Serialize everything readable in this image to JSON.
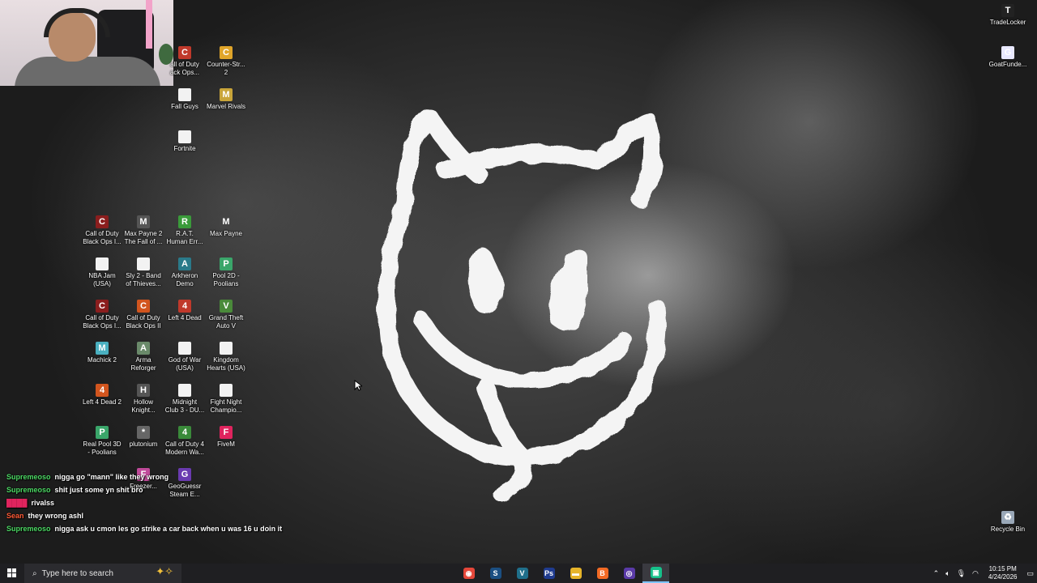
{
  "desktop": {
    "icons": [
      {
        "label": "all of Duty\nack Ops...",
        "glyph": "C",
        "color": "#c0392b"
      },
      {
        "label": "Counter-Str...\n2",
        "glyph": "C",
        "color": "#e0a52a"
      },
      {
        "label": "Fall Guys",
        "glyph": "",
        "color": "#f2f2f2"
      },
      {
        "label": "Marvel Rivals",
        "glyph": "M",
        "color": "#c9a53a"
      },
      {
        "label": "Fortnite",
        "glyph": "",
        "color": "#f2f2f2"
      },
      {
        "label": "Call of Duty\nBlack Ops I...",
        "glyph": "C",
        "color": "#8b1e1e"
      },
      {
        "label": "Max Payne 2\nThe Fall of ...",
        "glyph": "M",
        "color": "#555555"
      },
      {
        "label": "R.A.T.\nHuman Err...",
        "glyph": "R",
        "color": "#3a9b3a"
      },
      {
        "label": "Max Payne",
        "glyph": "M",
        "color": "#444444"
      },
      {
        "label": "NBA Jam\n(USA)",
        "glyph": "",
        "color": "#f2f2f2"
      },
      {
        "label": "Sly 2 - Band\nof Thieves...",
        "glyph": "",
        "color": "#f2f2f2"
      },
      {
        "label": "Arkheron\nDemo",
        "glyph": "A",
        "color": "#2a7a8a"
      },
      {
        "label": "Pool 2D -\nPoolians",
        "glyph": "P",
        "color": "#3aa66a"
      },
      {
        "label": "Call of Duty\nBlack Ops I...",
        "glyph": "C",
        "color": "#8b1e1e"
      },
      {
        "label": "Call of Duty\nBlack Ops II",
        "glyph": "C",
        "color": "#d2551e"
      },
      {
        "label": "Left 4 Dead",
        "glyph": "4",
        "color": "#c0392b"
      },
      {
        "label": "Grand Theft\nAuto V",
        "glyph": "V",
        "color": "#4a8a3a"
      },
      {
        "label": "Machick 2",
        "glyph": "M",
        "color": "#4ab0c0"
      },
      {
        "label": "Arma\nReforger",
        "glyph": "A",
        "color": "#6a8a6a"
      },
      {
        "label": "God of War\n(USA)",
        "glyph": "",
        "color": "#f2f2f2"
      },
      {
        "label": "Kingdom\nHearts (USA)",
        "glyph": "",
        "color": "#f2f2f2"
      },
      {
        "label": "Left 4 Dead 2",
        "glyph": "4",
        "color": "#d2551e"
      },
      {
        "label": "Hollow\nKnight...",
        "glyph": "H",
        "color": "#555555"
      },
      {
        "label": "Midnight\nClub 3 - DU...",
        "glyph": "",
        "color": "#f2f2f2"
      },
      {
        "label": "Fight Night\nChampio...",
        "glyph": "",
        "color": "#f2f2f2"
      },
      {
        "label": "Real Pool 3D\n- Poolians",
        "glyph": "P",
        "color": "#3aa66a"
      },
      {
        "label": "plutonium",
        "glyph": "*",
        "color": "#666666"
      },
      {
        "label": "Call of Duty 4\nModern Wa...",
        "glyph": "4",
        "color": "#3a8a3a"
      },
      {
        "label": "FiveM",
        "glyph": "F",
        "color": "#e0245e"
      },
      {
        "label": "Freezer...",
        "glyph": "F",
        "color": "#c04a9a"
      },
      {
        "label": "GeoGuessr\nSteam E...",
        "glyph": "G",
        "color": "#6a3ab0"
      },
      {
        "label": "TradeLocker",
        "glyph": "T",
        "color": "#222222"
      },
      {
        "label": "GoatFunde...",
        "glyph": "G",
        "color": "#e8e8ff"
      },
      {
        "label": "Recycle Bin",
        "glyph": "♻",
        "color": "#9aa8b8"
      }
    ]
  },
  "chat": {
    "messages": [
      {
        "user": "Supremeoso",
        "user_color": "#4cd964",
        "text": "nigga go \"mann\" like they wrong"
      },
      {
        "user": "Supremeoso",
        "user_color": "#4cd964",
        "text": "shit just some yn shit bro"
      },
      {
        "user": "████",
        "user_color": "#e0245e",
        "text": "rivalss"
      },
      {
        "user": "Sean",
        "user_color": "#ff5a36",
        "text": "they wrong ashl"
      },
      {
        "user": "Supremeoso",
        "user_color": "#4cd964",
        "text": "nigga ask u cmon les go strike a car back when u was 16 u doin it"
      }
    ]
  },
  "taskbar": {
    "search_placeholder": "Type here to search",
    "pinned": [
      {
        "name": "chrome",
        "glyph": "◉",
        "color": "#e5473a"
      },
      {
        "name": "steam",
        "glyph": "S",
        "color": "#1b4f82"
      },
      {
        "name": "vegas",
        "glyph": "V",
        "color": "#1f6f8b"
      },
      {
        "name": "photoshop",
        "glyph": "Ps",
        "color": "#1f3b8f"
      },
      {
        "name": "file-explorer",
        "glyph": "▬",
        "color": "#e6b42a"
      },
      {
        "name": "brave",
        "glyph": "B",
        "color": "#f26a24"
      },
      {
        "name": "obs",
        "glyph": "◎",
        "color": "#5a3aa8"
      },
      {
        "name": "app-active",
        "glyph": "▣",
        "color": "#16c08a"
      }
    ],
    "clock": {
      "time": "10:15 PM",
      "date": "4/24/2026"
    }
  }
}
